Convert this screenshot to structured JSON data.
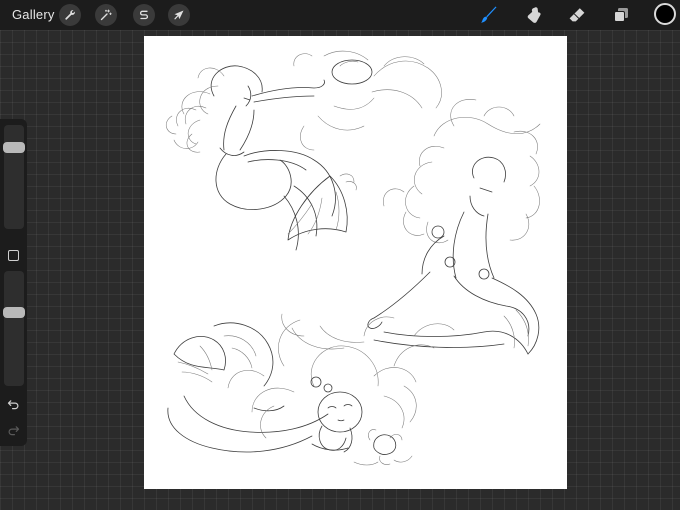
{
  "topbar": {
    "gallery_label": "Gallery",
    "left_tools": [
      {
        "name": "actions",
        "icon": "wrench-icon"
      },
      {
        "name": "adjustments",
        "icon": "magic-wand-icon"
      },
      {
        "name": "selection",
        "icon": "selection-s-icon"
      },
      {
        "name": "transform",
        "icon": "arrow-cursor-icon"
      }
    ],
    "right_tools": [
      {
        "name": "brush",
        "icon": "brush-icon",
        "active": true
      },
      {
        "name": "smudge",
        "icon": "smudge-icon",
        "active": false
      },
      {
        "name": "eraser",
        "icon": "eraser-icon",
        "active": false
      },
      {
        "name": "layers",
        "icon": "layers-icon",
        "active": false
      }
    ],
    "current_color": "#000000"
  },
  "sidebar": {
    "brush_size_level": 0.82,
    "opacity_level": 0.65,
    "modify_button_icon": "square-icon",
    "undo_icon": "undo-arrow-icon",
    "redo_icon": "redo-arrow-icon"
  },
  "canvas": {
    "background": "#ffffff",
    "artwork": "pencil-sketch-mermaids"
  },
  "colors": {
    "toolbar_bg": "#1c1c1c",
    "workspace_bg": "#2b2b2b",
    "accent_blue": "#1f8fff"
  }
}
